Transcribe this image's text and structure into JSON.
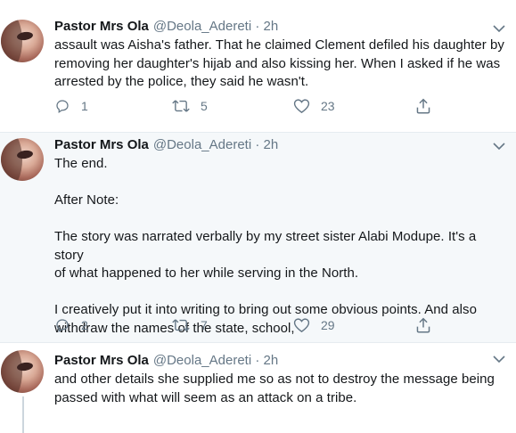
{
  "tweets": [
    {
      "name": "Pastor Mrs Ola",
      "handle": "@Deola_Adereti · 2h",
      "text": "assault was Aisha's father. That he claimed Clement defiled his daughter by\nremoving her daughter's hijab and also kissing her. When I asked if he was\narrested by the police, they said he wasn't.",
      "replies": "1",
      "retweets": "5",
      "likes": "23"
    },
    {
      "name": "Pastor Mrs Ola",
      "handle": "@Deola_Adereti · 2h",
      "text": "The end.\n\nAfter Note:\n\nThe story was narrated verbally by my street sister Alabi Modupe. It's a story\nof what happened to her while serving in the North.\n\nI creatively put it into writing to bring out some obvious points. And also\nwithdraw the names of the state, school,",
      "replies": "2",
      "retweets": "7",
      "likes": "29"
    },
    {
      "name": "Pastor Mrs Ola",
      "handle": "@Deola_Adereti · 2h",
      "text": "and other details she supplied me so as not to destroy the message being\npassed with what will seem as an attack on a tribe."
    }
  ],
  "icons": {
    "reply": "reply-icon",
    "retweet": "retweet-icon",
    "like": "heart-icon",
    "share": "share-icon",
    "caret": "chevron-down-icon"
  },
  "colors": {
    "text": "#14171a",
    "secondary": "#657786",
    "highlight_bg": "#f5f8fa",
    "thread_line": "#ccd6dd"
  }
}
